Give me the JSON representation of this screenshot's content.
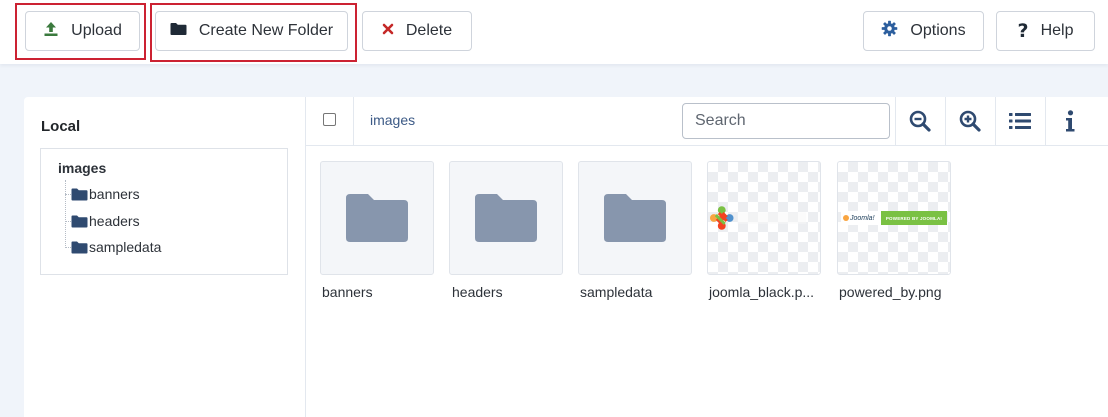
{
  "toolbar": {
    "upload_label": "Upload",
    "create_folder_label": "Create New Folder",
    "delete_label": "Delete",
    "options_label": "Options",
    "help_label": "Help"
  },
  "sidebar": {
    "title": "Local",
    "tree": {
      "root": "images",
      "children": [
        "banners",
        "headers",
        "sampledata"
      ]
    }
  },
  "browser": {
    "breadcrumb": "images",
    "search_placeholder": "Search",
    "items": [
      {
        "name": "banners",
        "type": "folder"
      },
      {
        "name": "headers",
        "type": "folder"
      },
      {
        "name": "sampledata",
        "type": "folder"
      },
      {
        "name": "joomla_black.p...",
        "type": "image"
      },
      {
        "name": "powered_by.png",
        "type": "image"
      }
    ],
    "powered_text": "POWERED BY JOOMLA!"
  },
  "icons": {
    "upload": "upload-icon",
    "folder": "folder-icon",
    "delete": "close-icon",
    "options": "gear-icon",
    "help": "question-icon",
    "zoom_out": "zoom-out-icon",
    "zoom_in": "zoom-in-icon",
    "list": "list-view-icon",
    "info": "info-icon"
  },
  "colors": {
    "highlight": "#cc2232",
    "upload_green": "#3b7a3e",
    "delete_red": "#c52827",
    "accent_blue": "#2d5f9e",
    "folder_gray": "#8796ad",
    "tree_folder": "#2f4a70",
    "joomla_green": "#7ac143"
  }
}
